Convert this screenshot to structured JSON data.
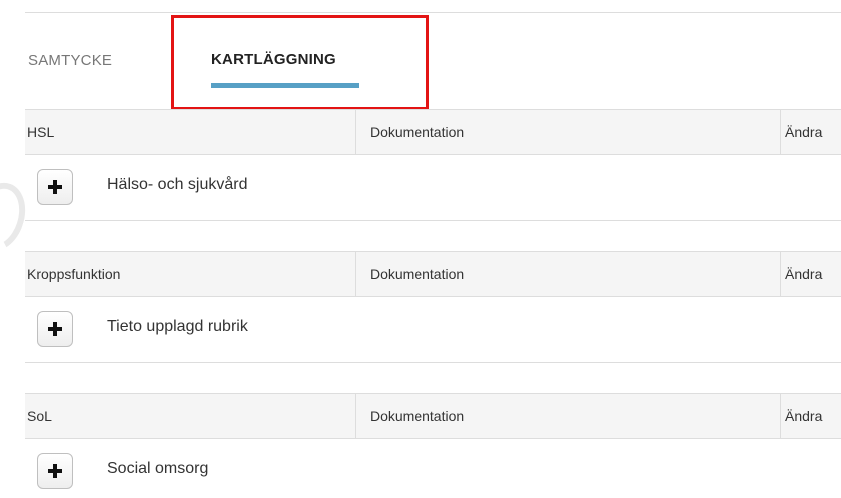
{
  "tabs": [
    {
      "label": "SAMTYCKE",
      "active": false
    },
    {
      "label": "KARTLÄGGNING",
      "active": true
    }
  ],
  "colors": {
    "active_tab_underline": "#57a0c5",
    "highlight_box": "#e31414",
    "header_background": "#f5f5f5"
  },
  "sections": [
    {
      "title": "HSL",
      "documentation": "Dokumentation",
      "changed": "Ändra",
      "add_icon": "plus-icon",
      "item_label": "Hälso- och sjukvård"
    },
    {
      "title": "Kroppsfunktion",
      "documentation": "Dokumentation",
      "changed": "Ändra",
      "add_icon": "plus-icon",
      "item_label": "Tieto upplagd rubrik"
    },
    {
      "title": "SoL",
      "documentation": "Dokumentation",
      "changed": "Ändra",
      "add_icon": "plus-icon",
      "item_label": "Social omsorg"
    }
  ]
}
